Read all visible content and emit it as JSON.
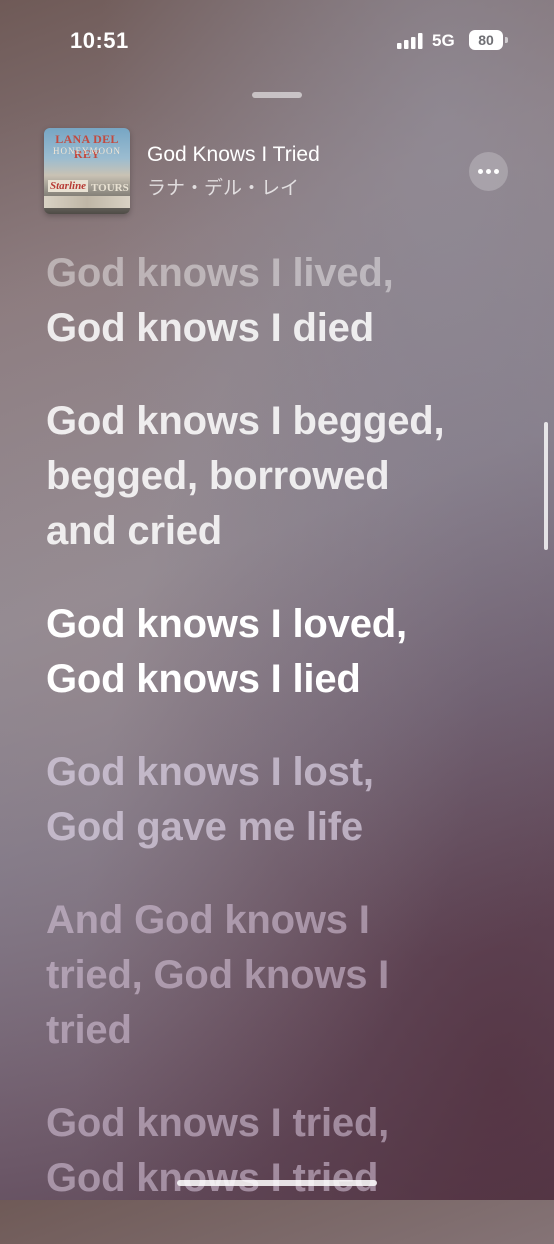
{
  "status_bar": {
    "time": "10:51",
    "network": "5G",
    "battery": "80"
  },
  "now_playing": {
    "album_art": {
      "artist": "LANA DEL REY",
      "album": "HONEYMOON",
      "sign": "Starline",
      "sign2": "TOURS"
    },
    "title": "God Knows I Tried",
    "artist": "ラナ・デル・レイ"
  },
  "lyrics": [
    {
      "lines": [
        "God knows I lived,",
        "God knows I died"
      ]
    },
    {
      "lines": [
        "God knows I begged,",
        "begged, borrowed",
        "and cried"
      ]
    },
    {
      "lines": [
        "God knows I loved,",
        "God knows I lied"
      ]
    },
    {
      "lines": [
        "God knows I lost,",
        "God gave me life"
      ]
    },
    {
      "lines": [
        "And God knows I",
        "tried, God knows I",
        "tried"
      ]
    },
    {
      "lines": [
        "God knows I tried,",
        "God knows I tried"
      ]
    }
  ],
  "colors": {
    "accent": "#ffffff",
    "background_top": "#6f5a57",
    "background_bottom": "#5a4150"
  }
}
